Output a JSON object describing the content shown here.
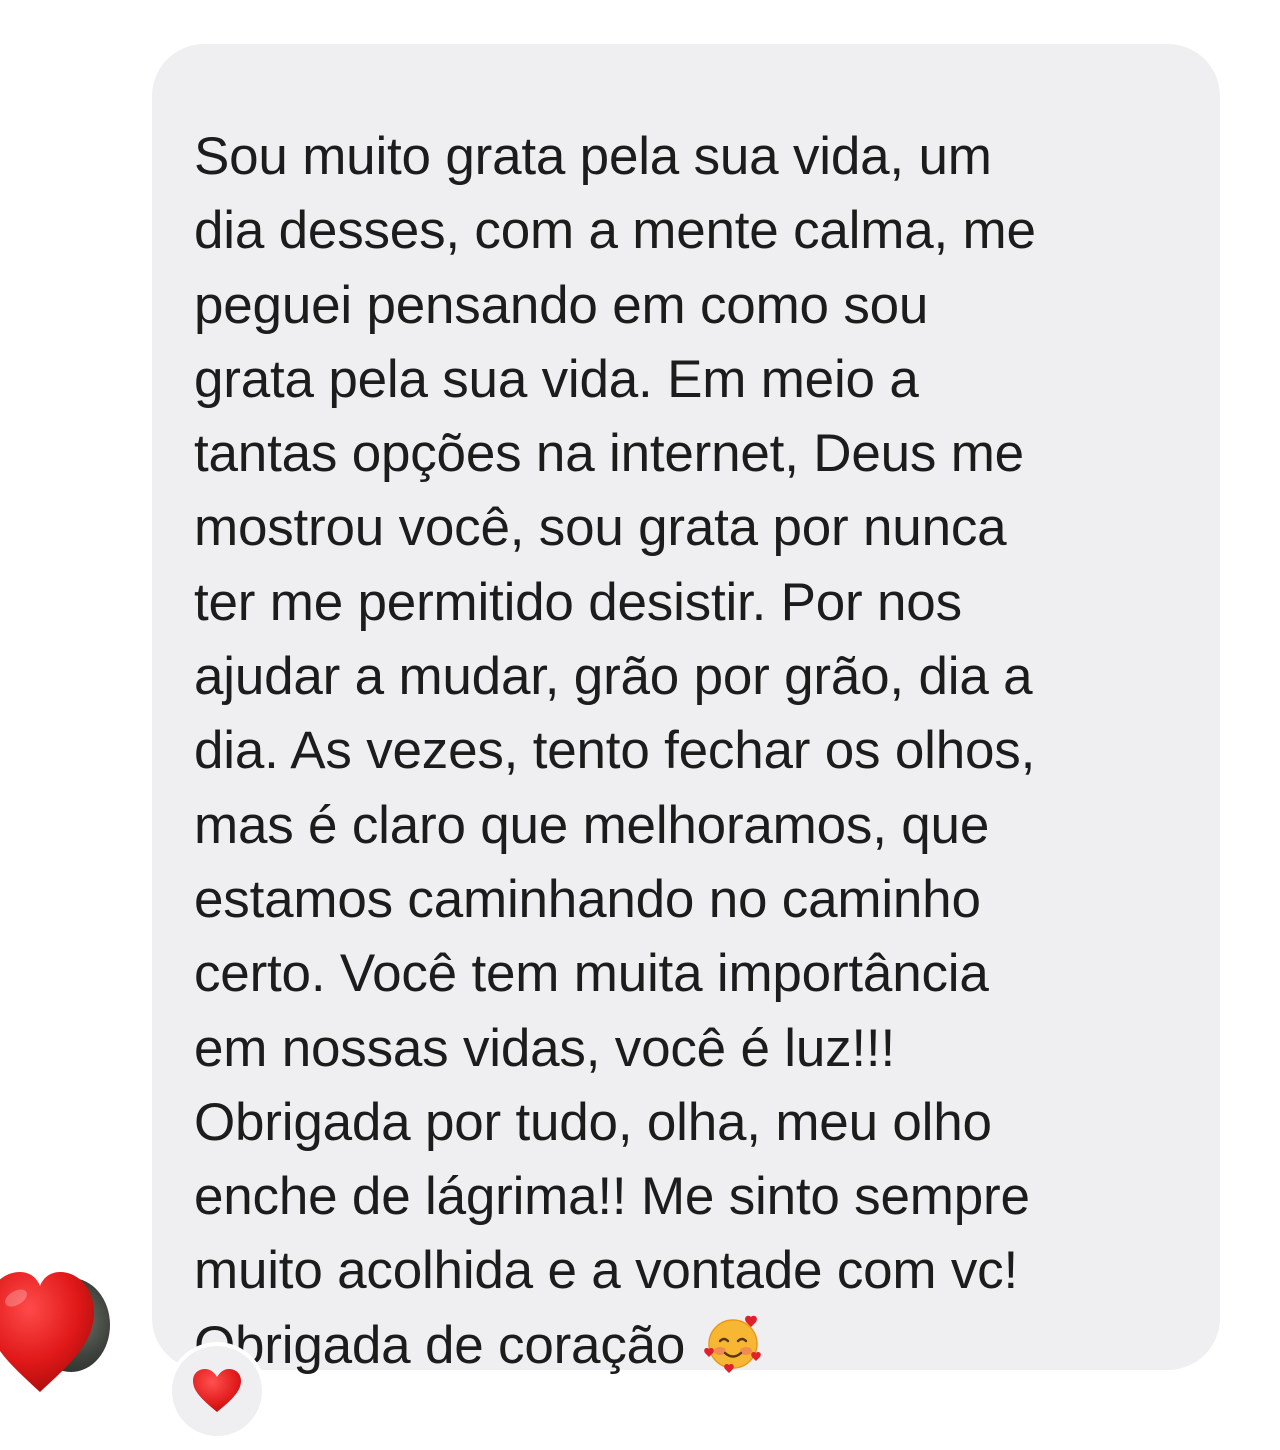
{
  "message": {
    "lines": [
      "Sou muito grata pela sua vida, um",
      "dia desses, com a mente calma, me",
      "peguei pensando em como sou",
      "grata pela sua vida. Em meio a",
      "tantas opções na internet, Deus me",
      "mostrou você, sou grata por nunca",
      "ter me permitido desistir. Por nos",
      "ajudar a mudar, grão por grão, dia a",
      "dia. As vezes, tento fechar os olhos,",
      "mas é claro que melhoramos, que",
      "estamos caminhando no caminho",
      "certo. Você tem muita importância",
      "em nossas vidas, você é luz!!!",
      "Obrigada por tudo, olha, meu olho",
      "enche de lágrima!! Me sinto sempre",
      "muito acolhida e a vontade com vc!",
      "Obrigada de coração"
    ],
    "trailing_emoji": "smiling-face-with-hearts-icon",
    "reaction": "red-heart-icon"
  },
  "colors": {
    "bubble": "#efeff1",
    "text": "#1c1c1c",
    "heart": "#e0202a"
  }
}
